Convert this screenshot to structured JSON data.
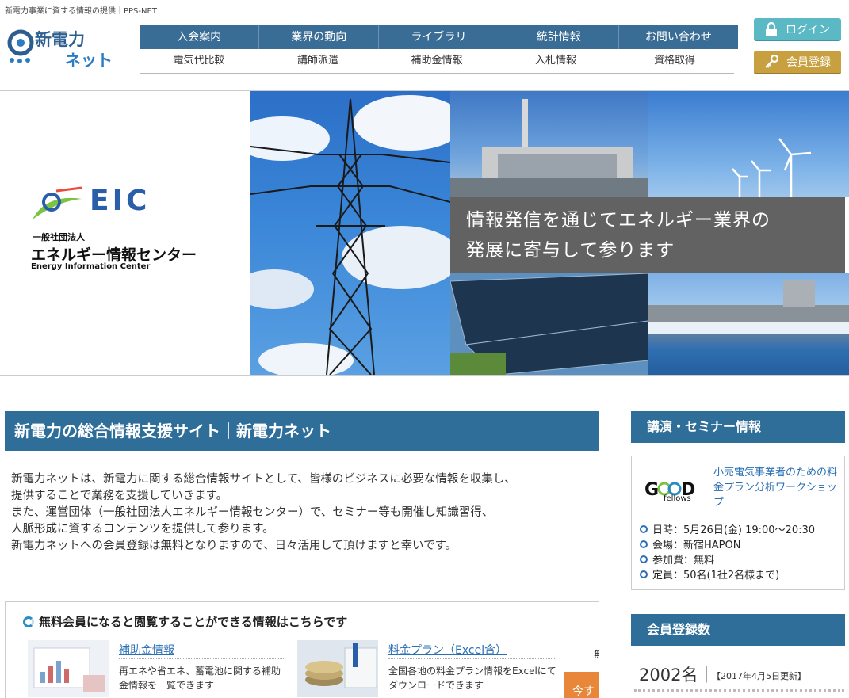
{
  "header": {
    "tagline": "新電力事業に資する情報の提供｜PPS-NET",
    "logo_line1": "新電力",
    "logo_line2": "ネット"
  },
  "nav_primary": [
    "入会案内",
    "業界の動向",
    "ライブラリ",
    "統計情報",
    "お問い合わせ"
  ],
  "nav_secondary": [
    "電気代比較",
    "講師派遣",
    "補助金情報",
    "入札情報",
    "資格取得"
  ],
  "buttons": {
    "login": "ログイン",
    "register": "会員登録"
  },
  "hero": {
    "eic_logo": "EIC",
    "eic_type": "一般社団法人",
    "eic_name": "エネルギー情報センター",
    "eic_english": "Energy Information Center",
    "caption_line1": "情報発信を通じてエネルギー業界の",
    "caption_line2": "発展に寄与して参ります"
  },
  "main": {
    "title": "新電力の総合情報支援サイト｜新電力ネット",
    "intro": [
      "新電力ネットは、新電力に関する総合情報サイトとして、皆様のビジネスに必要な情報を収集し、",
      "提供することで業務を支援していきます。",
      "また、運営団体（一般社団法人エネルギー情報センター）で、セミナー等も開催し知識習得、",
      "人脈形成に資するコンテンツを提供して参ります。",
      "新電力ネットへの会員登録は無料となりますので、日々活用して頂けますと幸いです。"
    ],
    "free_section_title": "無料会員になると閲覧することができる情報はこちらです",
    "cards": [
      {
        "title": "補助金情報",
        "desc": "再エネや省エネ、蓄電池に関する補助金情報を一覧できます"
      },
      {
        "title": "料金プラン（Excel含）",
        "desc": "全国各地の料金プラン情報をExcelにてダウンロードできます"
      }
    ],
    "edge_char": "無",
    "orange_label": "今す"
  },
  "sidebar": {
    "seminar_heading": "講演・セミナー情報",
    "seminar_logo_text": "fellows",
    "seminar_title": "小売電気事業者のための料金プラン分析ワークショップ",
    "seminar_details": [
      "日時：5月26日(金) 19:00～20:30",
      "会場：新宿HAPON",
      "参加費：無料",
      "定員：50名(1社2名様まで)"
    ],
    "members_heading": "会員登録数",
    "members_count": "2002名｜",
    "members_updated": "【2017年4月5日更新】"
  },
  "colors": {
    "nav": "#3a6d96",
    "heading": "#2e6e99",
    "login": "#5bb8c5",
    "register": "#c8a040",
    "accent": "#e8873a"
  }
}
